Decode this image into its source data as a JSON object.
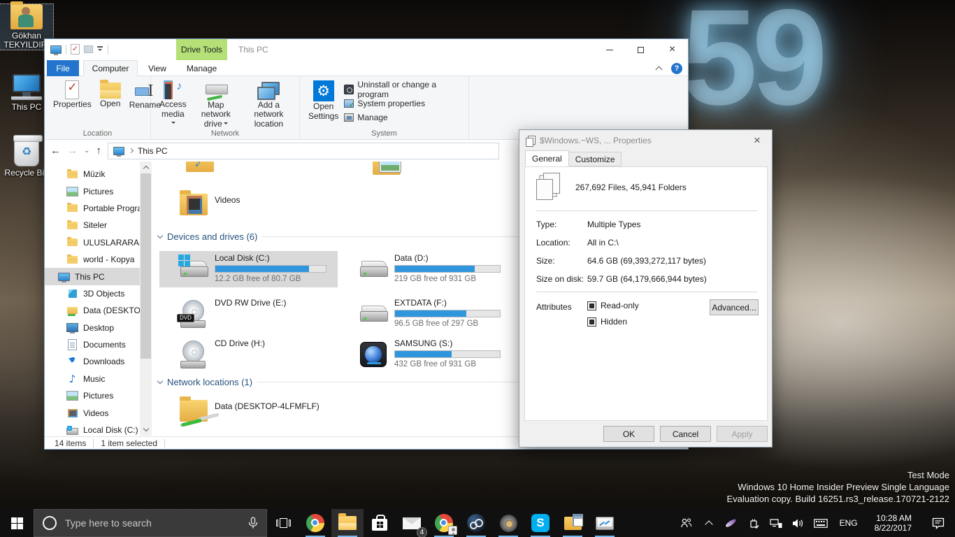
{
  "colors": {
    "accent_blue": "#2374cc",
    "usage_bar_blue": "#2f96dd",
    "drive_tools_green": "#b4e077",
    "selection_gray": "#d9d9d9",
    "taskbar_black": "#101010"
  },
  "desktop": {
    "glow_text": "59",
    "icons": [
      {
        "label": "Gökhan TEKYILDIRI"
      },
      {
        "label": "This PC"
      },
      {
        "label": "Recycle Bin"
      }
    ],
    "watermark": {
      "line1": "Test Mode",
      "line2": "Windows 10 Home Insider Preview Single Language",
      "line3": "Evaluation copy. Build 16251.rs3_release.170721-2122"
    }
  },
  "explorer": {
    "window_title": "This PC",
    "context_tab": "Drive Tools",
    "tabs": {
      "file": "File",
      "computer": "Computer",
      "view": "View",
      "manage": "Manage"
    },
    "ribbon": {
      "location_group": {
        "label": "Location",
        "properties": "Properties",
        "open": "Open",
        "rename": "Rename"
      },
      "network_group": {
        "label": "Network",
        "access_media_1": "Access",
        "access_media_2": "media",
        "map_drive_1": "Map network",
        "map_drive_2": "drive",
        "add_location_1": "Add a network",
        "add_location_2": "location"
      },
      "system_group": {
        "label": "System",
        "open_settings_1": "Open",
        "open_settings_2": "Settings",
        "uninstall": "Uninstall or change a program",
        "system_properties": "System properties",
        "manage": "Manage"
      }
    },
    "address_bar": {
      "path": "This PC"
    },
    "sidebar": {
      "items": [
        {
          "label": "Müzik"
        },
        {
          "label": "Pictures"
        },
        {
          "label": "Portable Progra"
        },
        {
          "label": "Siteler"
        },
        {
          "label": "ULUSLARARASI İ"
        },
        {
          "label": "world - Kopya"
        },
        {
          "label": "This PC"
        },
        {
          "label": "3D Objects"
        },
        {
          "label": "Data (DESKTOP-.."
        },
        {
          "label": "Desktop"
        },
        {
          "label": "Documents"
        },
        {
          "label": "Downloads"
        },
        {
          "label": "Music"
        },
        {
          "label": "Pictures"
        },
        {
          "label": "Videos"
        },
        {
          "label": "Local Disk (C:)"
        }
      ]
    },
    "content": {
      "sections": {
        "devices": "Devices and drives (6)",
        "network": "Network locations (1)"
      },
      "videos_folder": {
        "label": "Videos"
      },
      "drives": [
        {
          "name": "Local Disk (C:)",
          "free": "12.2 GB free of 80.7 GB",
          "used_pct": 85
        },
        {
          "name": "Data (D:)",
          "free": "219 GB free of 931 GB",
          "used_pct": 76
        },
        {
          "name": "DVD RW Drive (E:)",
          "badge": "DVD"
        },
        {
          "name": "EXTDATA (F:)",
          "free": "96.5 GB free of 297 GB",
          "used_pct": 68
        },
        {
          "name": "CD Drive (H:)"
        },
        {
          "name": "SAMSUNG (S:)",
          "free": "432 GB free of 931 GB",
          "used_pct": 54
        }
      ],
      "network_locations": [
        {
          "name": "Data (DESKTOP-4LFMFLF)"
        }
      ]
    },
    "status_bar": {
      "count": "14 items",
      "selection": "1 item selected"
    }
  },
  "dialog": {
    "title": "$Windows.~WS, ... Properties",
    "tabs": {
      "general": "General",
      "customize": "Customize"
    },
    "summary": "267,692 Files,  45,941 Folders",
    "rows": [
      {
        "label": "Type:",
        "value": "Multiple Types"
      },
      {
        "label": "Location:",
        "value": "All in C:\\"
      },
      {
        "label": "Size:",
        "value": "64.6 GB (69,393,272,117 bytes)"
      },
      {
        "label": "Size on disk:",
        "value": "59.7 GB (64,179,666,944 bytes)"
      }
    ],
    "attributes": {
      "label": "Attributes",
      "readonly_label": "Read-only",
      "readonly_state": "mixed",
      "hidden_label": "Hidden",
      "hidden_state": "mixed",
      "advanced_button": "Advanced..."
    },
    "buttons": {
      "ok": "OK",
      "cancel": "Cancel",
      "apply": "Apply"
    }
  },
  "taskbar": {
    "search": {
      "placeholder": "Type here to search"
    },
    "app_icons": [
      "task-view",
      "chrome",
      "file-explorer",
      "microsoft-store",
      "mail",
      "chrome-profile",
      "steam",
      "disk-manager",
      "skype",
      "program-folder",
      "system-monitor"
    ],
    "mail_badge": "4",
    "tray_icons": [
      "people",
      "chevron-up",
      "pen",
      "usb",
      "network",
      "volume",
      "touch-keyboard"
    ],
    "language": "ENG",
    "clock": {
      "time": "10:28 AM",
      "date": "8/22/2017"
    }
  }
}
